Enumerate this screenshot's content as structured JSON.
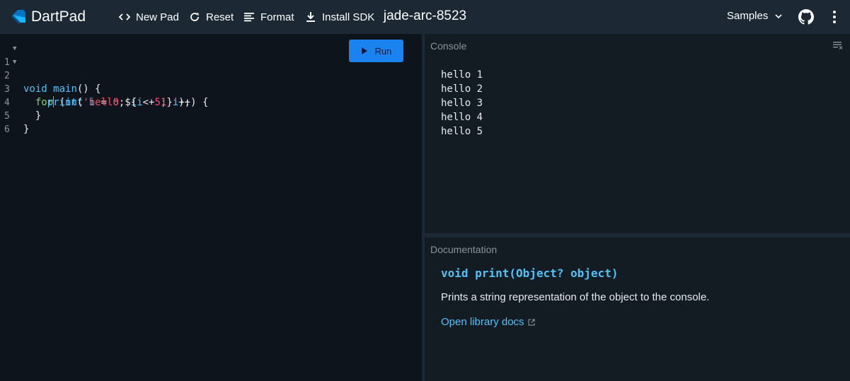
{
  "app": {
    "name": "DartPad",
    "pad_title": "jade-arc-8523"
  },
  "toolbar": {
    "new_pad": "New Pad",
    "reset": "Reset",
    "format": "Format",
    "install_sdk": "Install SDK",
    "samples": "Samples"
  },
  "icons": {
    "logo": "dart-logo-icon",
    "new_pad": "code-brackets-icon",
    "reset": "refresh-icon",
    "format": "format-lines-icon",
    "install_sdk": "download-icon",
    "samples": "chevron-down-icon",
    "github": "github-icon",
    "more": "more-vert-icon",
    "run": "play-icon",
    "clear": "clear-console-icon",
    "external": "external-link-icon"
  },
  "editor": {
    "line_numbers": [
      "1",
      "2",
      "3",
      "4",
      "5",
      "6"
    ],
    "run_label": "Run"
  },
  "console": {
    "title": "Console",
    "output": [
      "hello 1",
      "hello 2",
      "hello 3",
      "hello 4",
      "hello 5"
    ]
  },
  "documentation": {
    "title": "Documentation",
    "signature": "void print(Object? object)",
    "description": "Prints a string representation of the object to the console.",
    "link": "Open library docs"
  },
  "colors": {
    "topbar": "#1c2834",
    "editor_bg": "#0e141b",
    "panel_bg": "#131b23",
    "accent_blue": "#1a83f0",
    "keyword": "#4fc3f7",
    "control": "#7fd17a",
    "string": "#f0506e"
  }
}
